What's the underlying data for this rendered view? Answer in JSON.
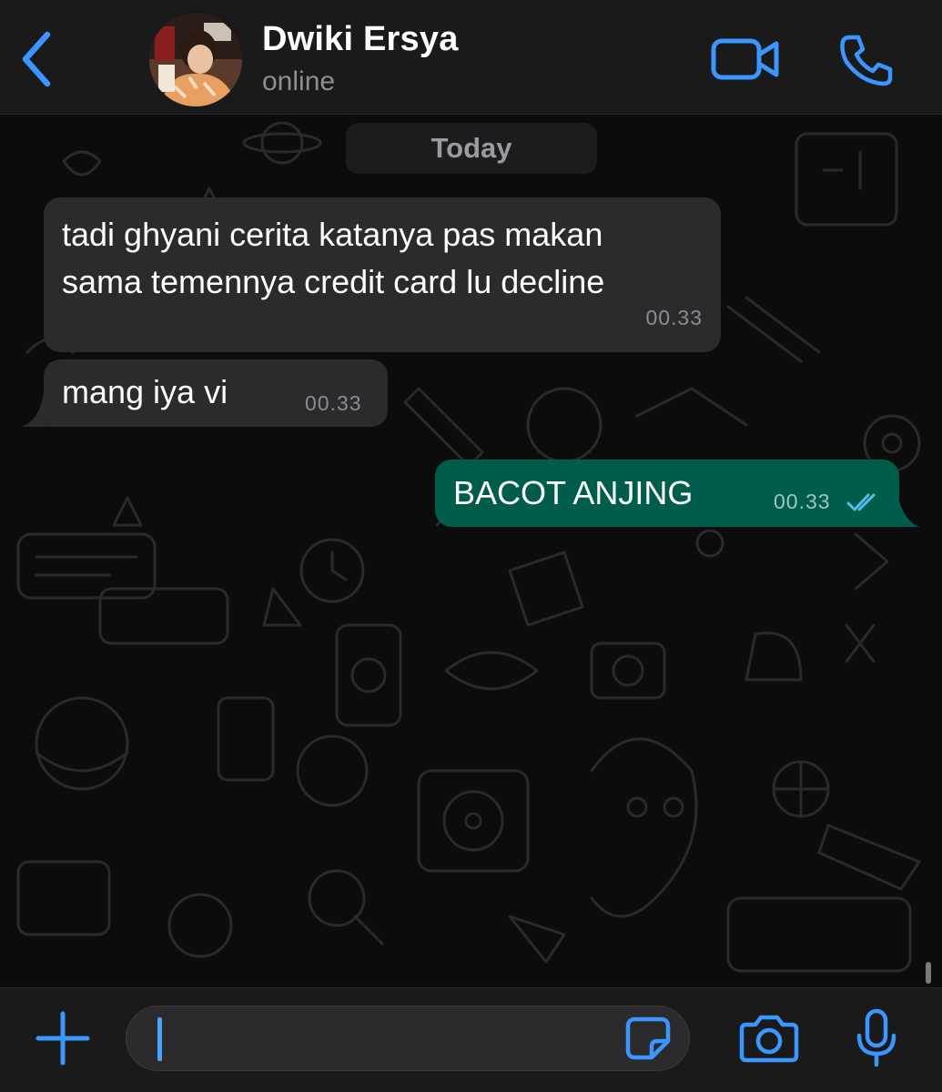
{
  "header": {
    "contact_name": "Dwiki Ersya",
    "status": "online",
    "back_icon": "chevron-left-icon",
    "video_icon": "video-camera-icon",
    "call_icon": "phone-icon"
  },
  "chat": {
    "date_label": "Today",
    "messages": [
      {
        "direction": "incoming",
        "text": "tadi ghyani cerita katanya pas makan\nsama temennya credit card lu decline",
        "time": "00.33"
      },
      {
        "direction": "incoming",
        "text": "mang iya vi",
        "time": "00.33"
      },
      {
        "direction": "outgoing",
        "text": "BACOT ANJING",
        "time": "00.33",
        "status": "read"
      }
    ]
  },
  "input_bar": {
    "value": "",
    "plus_icon": "plus-icon",
    "sticker_icon": "sticker-icon",
    "camera_icon": "camera-icon",
    "mic_icon": "microphone-icon"
  },
  "colors": {
    "accent": "#3b96ff",
    "incoming_bubble": "#2b2b2d",
    "outgoing_bubble": "#005c4b",
    "read_ticks": "#53bdeb",
    "background": "#0c0c0d"
  }
}
